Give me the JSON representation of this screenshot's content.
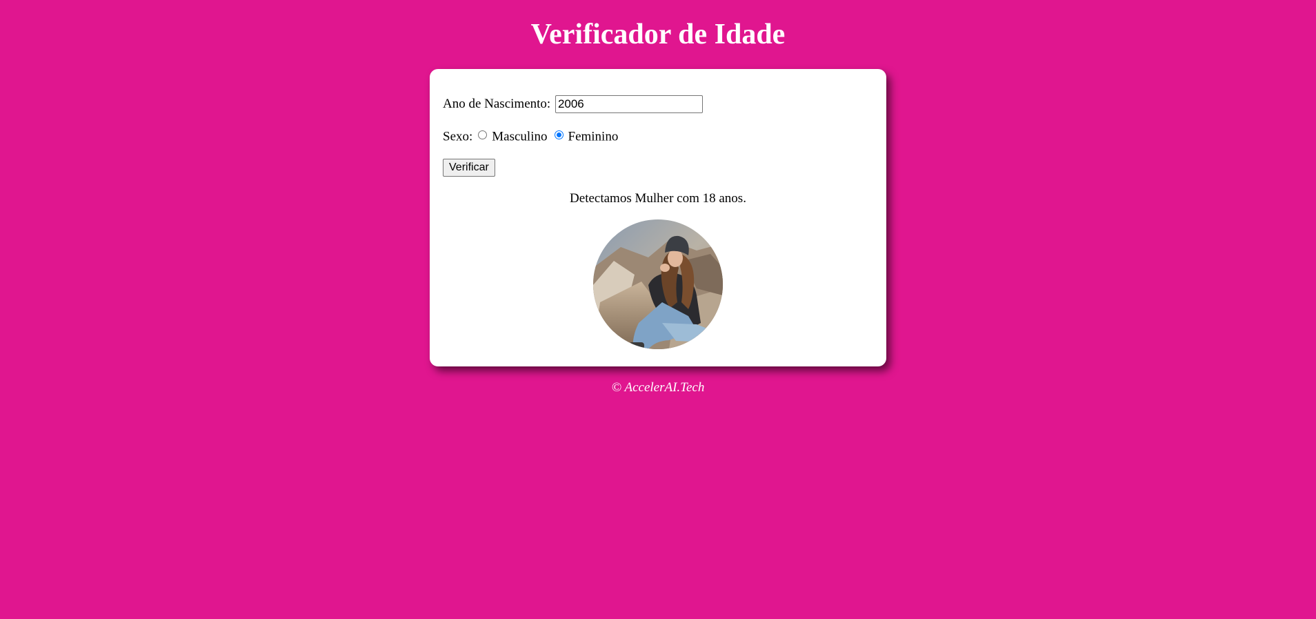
{
  "header": {
    "title": "Verificador de Idade"
  },
  "form": {
    "year_label": "Ano de Nascimento:",
    "year_value": "2006",
    "sex_label": "Sexo:",
    "options": [
      {
        "label": "Masculino",
        "checked": false
      },
      {
        "label": "Feminino",
        "checked": true
      }
    ],
    "submit_label": "Verificar"
  },
  "result": {
    "text": "Detectamos Mulher com 18 anos.",
    "image_icon": "photo-young-woman-sitting-on-rocks"
  },
  "footer": {
    "text": "© AccelerAI.Tech"
  },
  "colors": {
    "background": "#e0168f",
    "card": "#ffffff",
    "radio_accent": "#0075ff"
  }
}
